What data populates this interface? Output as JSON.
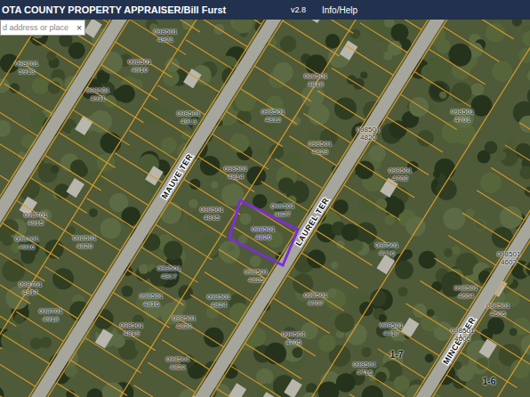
{
  "header": {
    "title": "OTA COUNTY PROPERTY APPRAISER/Bill Furst",
    "version": "v2.8",
    "help": "Info/Help"
  },
  "search": {
    "placeholder": "d address or place",
    "clear": "×"
  },
  "streets": [
    {
      "name": "MAUVE TER"
    },
    {
      "name": "LAUREL TER"
    },
    {
      "name": "MINCEY TER"
    }
  ],
  "blocks": [
    "1-7",
    "1-6"
  ],
  "parcels": [
    {
      "line1": "098501",
      "line2": "4921",
      "selected": false
    },
    {
      "line1": "098501",
      "line2": "4910",
      "selected": false
    },
    {
      "line1": "098701",
      "line2": "5913",
      "selected": false
    },
    {
      "line1": "098501",
      "line2": "4911",
      "selected": false
    },
    {
      "line1": "098501",
      "line2": "4913",
      "selected": false
    },
    {
      "line1": "098501",
      "line2": "4818",
      "selected": false
    },
    {
      "line1": "098501",
      "line2": "4812",
      "selected": false
    },
    {
      "line1": "098501",
      "line2": "4820",
      "selected": false
    },
    {
      "line1": "098501",
      "line2": "4829",
      "selected": false
    },
    {
      "line1": "098501",
      "line2": "4814",
      "selected": false
    },
    {
      "line1": "098501",
      "line2": "4827",
      "selected": false
    },
    {
      "line1": "098501",
      "line2": "4815",
      "selected": false
    },
    {
      "line1": "098501",
      "line2": "4826",
      "selected": true
    },
    {
      "line1": "098501",
      "line2": "4702",
      "selected": false
    },
    {
      "line1": "098501",
      "line2": "4701",
      "selected": false
    },
    {
      "line1": "098501",
      "line2": "4716",
      "selected": false
    },
    {
      "line1": "098501",
      "line2": "4603",
      "selected": false
    },
    {
      "line1": "098501",
      "line2": "4604",
      "selected": false
    },
    {
      "line1": "098501",
      "line2": "4825",
      "selected": false
    },
    {
      "line1": "098501",
      "line2": "4817",
      "selected": false
    },
    {
      "line1": "098501",
      "line2": "4816",
      "selected": false
    },
    {
      "line1": "098501",
      "line2": "4824",
      "selected": false
    },
    {
      "line1": "098501",
      "line2": "4820",
      "selected": false
    },
    {
      "line1": "098701",
      "line2": "4915",
      "selected": false
    },
    {
      "line1": "098701",
      "line2": "4916",
      "selected": false
    },
    {
      "line1": "098701",
      "line2": "4917",
      "selected": false
    },
    {
      "line1": "098701",
      "line2": "4918",
      "selected": false
    },
    {
      "line1": "098501",
      "line2": "4819",
      "selected": false
    },
    {
      "line1": "098501",
      "line2": "4821",
      "selected": false
    },
    {
      "line1": "098501",
      "line2": "4822",
      "selected": false
    },
    {
      "line1": "098501",
      "line2": "4707",
      "selected": false
    },
    {
      "line1": "098501",
      "line2": "4705",
      "selected": false
    },
    {
      "line1": "098501",
      "line2": "4717",
      "selected": false
    },
    {
      "line1": "098501",
      "line2": "4715",
      "selected": false
    },
    {
      "line1": "098501",
      "line2": "4606",
      "selected": false
    },
    {
      "line1": "098501",
      "line2": "4605",
      "selected": false
    },
    {
      "line1": "098501",
      "line2": "4833",
      "selected": false
    }
  ]
}
